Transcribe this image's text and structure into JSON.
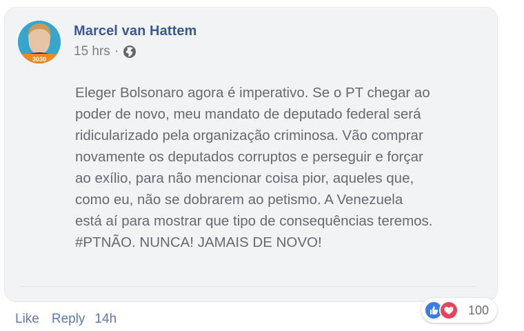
{
  "comment": {
    "author": "Marcel van Hattem",
    "time": "15 hrs",
    "separator": "·",
    "privacy_icon": "globe-icon",
    "avatar_badge": "3030",
    "text_lines": [
      "Eleger Bolsonaro agora é imperativo. Se o PT chegar ao",
      "poder de novo, meu mandato de deputado federal será",
      "ridicularizado pela organização criminosa. Vão comprar",
      "novamente os deputados corruptos e perseguir e forçar",
      "ao exílio, para não mencionar coisa pior, aqueles que,",
      "como eu, não se dobrarem ao petismo. A Venezuela",
      "está aí para mostrar que tipo de consequências teremos.",
      "#PTNÃO. NUNCA! JAMAIS DE NOVO!"
    ]
  },
  "actions": {
    "like": "Like",
    "reply": "Reply",
    "timeago": "14h"
  },
  "reactions": {
    "icons": [
      "like-reaction-icon",
      "love-reaction-icon"
    ],
    "count": "100"
  },
  "colors": {
    "author": "#385898",
    "link": "#5e7bb0",
    "bubble": "#f2f3f5",
    "like": "#3b7ce6",
    "love": "#e9435b"
  }
}
